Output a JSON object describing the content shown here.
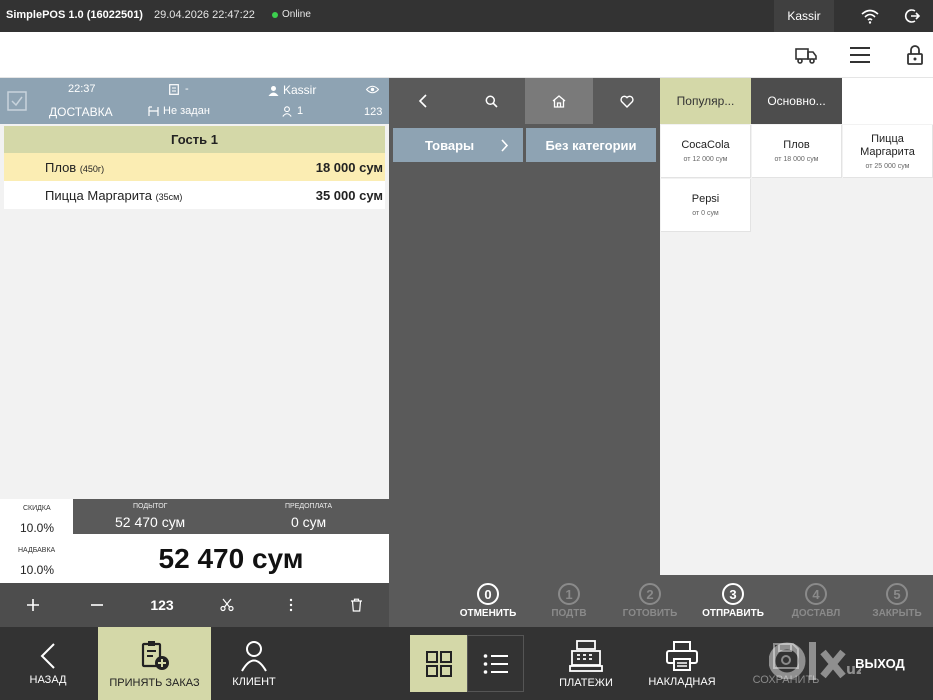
{
  "app": {
    "title": "SimplePOS 1.0 (16022501)",
    "datetime": "29.04.2026 22:47:22",
    "status": "Online",
    "status_color": "#3ccf4e",
    "user": "Kassir"
  },
  "order_header": {
    "time": "22:37",
    "order_type": "ДОСТАВКА",
    "doc_value": "-",
    "table": "Не задан",
    "waiter": "Kassir",
    "guests": "1",
    "number": "123"
  },
  "order": {
    "guest_label": "Гость 1",
    "items": [
      {
        "name": "Плов",
        "portion": "(450г)",
        "price": "18 000 сум"
      },
      {
        "name": "Пицца Маргарита",
        "portion": "(35см)",
        "price": "35 000 сум"
      }
    ]
  },
  "totals": {
    "discount_label": "СКИДКА",
    "discount_value": "10.0%",
    "markup_label": "НАДБАВКА",
    "markup_value": "10.0%",
    "subtotal_label": "ПОДЫТОГ",
    "subtotal_value": "52 470 сум",
    "prepay_label": "ПРЕДОПЛАТА",
    "prepay_value": "0 сум",
    "grand_total": "52 470 сум"
  },
  "order_actions": {
    "numpad_label": "123"
  },
  "categories": [
    {
      "label": "Товары"
    },
    {
      "label": "Без категории"
    }
  ],
  "product_tabs": [
    {
      "label": "Популяр...",
      "active": true
    },
    {
      "label": "Основно...",
      "active": false
    }
  ],
  "products": [
    {
      "name": "CocaCola",
      "price": "от 12 000 сум"
    },
    {
      "name": "Плов",
      "price": "от 18 000 сум"
    },
    {
      "name": "Пицца Маргарита",
      "price": "от 25 000 сум"
    },
    {
      "name": "Pepsi",
      "price": "от 0 сум"
    }
  ],
  "steps": [
    {
      "num": "0",
      "label": "ОТМЕНИТЬ",
      "enabled": true
    },
    {
      "num": "1",
      "label": "ПОДТВ",
      "enabled": false
    },
    {
      "num": "2",
      "label": "ГОТОВИТЬ",
      "enabled": false
    },
    {
      "num": "3",
      "label": "ОТПРАВИТЬ",
      "enabled": true
    },
    {
      "num": "4",
      "label": "ДОСТАВЛ",
      "enabled": false
    },
    {
      "num": "5",
      "label": "ЗАКРЫТЬ",
      "enabled": false
    }
  ],
  "bottom": {
    "back": "НАЗАД",
    "accept": "ПРИНЯТЬ ЗАКАЗ",
    "client": "КЛИЕНТ",
    "payments": "ПЛАТЕЖИ",
    "invoice": "НАКЛАДНАЯ",
    "save": "СОХРАНИТЬ",
    "exit": "ВЫХОД"
  },
  "colors": {
    "accent": "#d4d8a8",
    "header_blue": "#8ea3b3",
    "dark": "#333333",
    "panel": "#5a5a5a"
  }
}
